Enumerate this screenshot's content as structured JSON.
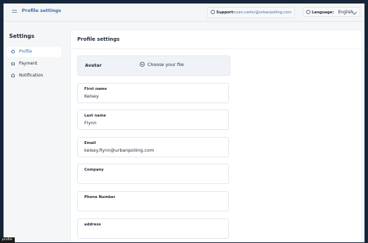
{
  "header": {
    "title": "Profile settings",
    "support_label": "Support:",
    "support_value": "ryan.carter@urbanpolling.com",
    "language_label": "Language:",
    "language_value": "English"
  },
  "sidebar": {
    "title": "Settings",
    "items": [
      {
        "label": "Profile",
        "icon": "user-circle-icon",
        "active": true
      },
      {
        "label": "Payment",
        "icon": "card-icon",
        "active": false
      },
      {
        "label": "Notification",
        "icon": "bell-icon",
        "active": false
      }
    ]
  },
  "main": {
    "title": "Profile settings",
    "avatar_label": "Avatar",
    "choose_file": "Choose your file",
    "fields": [
      {
        "label": "First name",
        "value": "Kelsey"
      },
      {
        "label": "Last name",
        "value": "Flynn"
      },
      {
        "label": "Email",
        "value": "kelsey.flynn@urbanpolling.com"
      },
      {
        "label": "Company",
        "value": ""
      },
      {
        "label": "Phone Number",
        "value": ""
      },
      {
        "label": "address",
        "value": ""
      }
    ]
  },
  "tooltip": "profile",
  "colors": {
    "accent": "#3a6fb0",
    "background": "#15263a"
  }
}
